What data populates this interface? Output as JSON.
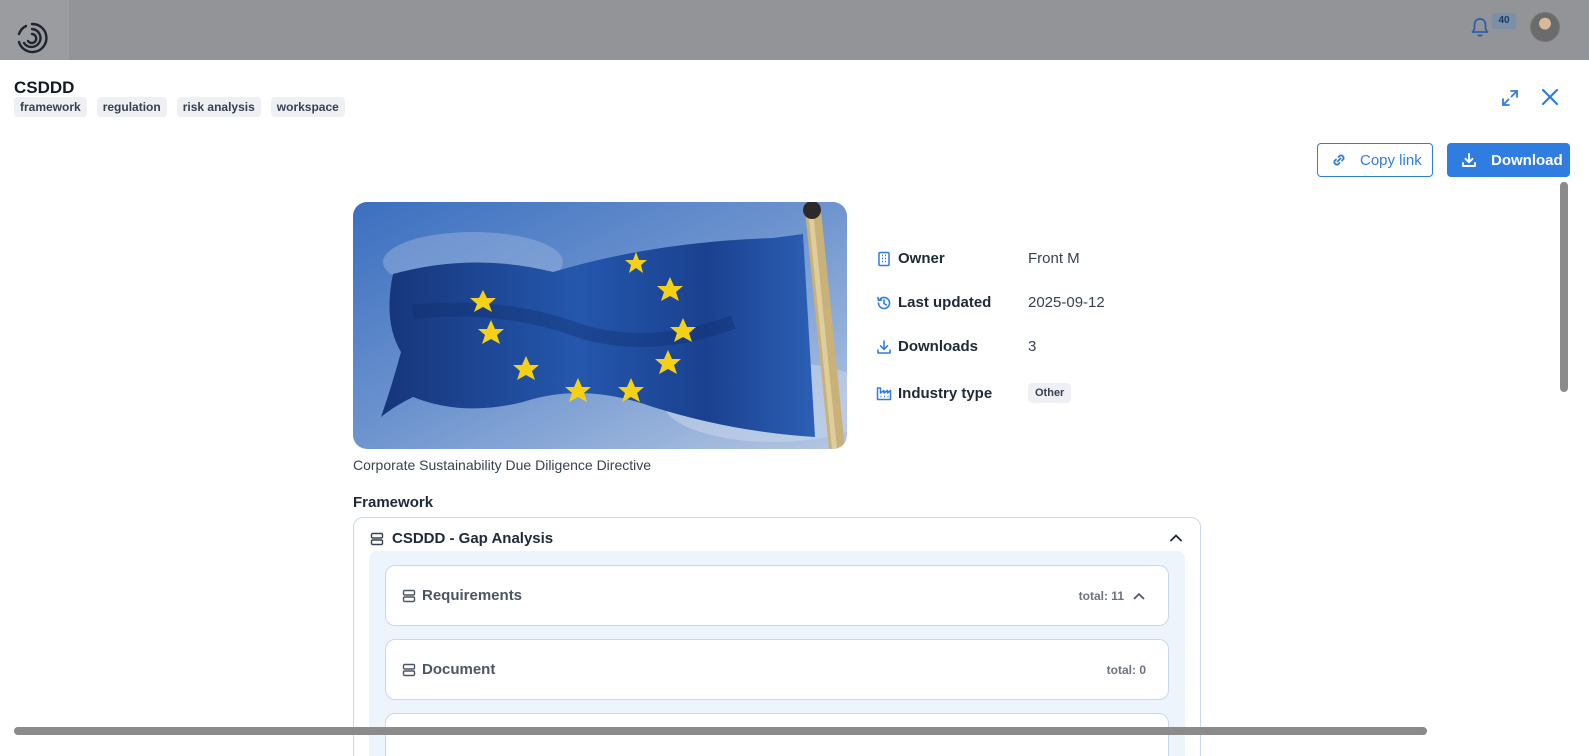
{
  "header": {
    "notification_count": "40"
  },
  "modal": {
    "title": "CSDDD",
    "tags": [
      "framework",
      "regulation",
      "risk analysis",
      "workspace"
    ],
    "copy_link_label": "Copy link",
    "download_label": "Download"
  },
  "resource": {
    "caption": "Corporate Sustainability Due Diligence Directive",
    "meta": {
      "owner_label": "Owner",
      "owner_value": "Front M",
      "updated_label": "Last updated",
      "updated_value": "2025-09-12",
      "downloads_label": "Downloads",
      "downloads_value": "3",
      "industry_label": "Industry type",
      "industry_value": "Other"
    }
  },
  "framework": {
    "section_label": "Framework",
    "name": "CSDDD - Gap Analysis",
    "items": [
      {
        "label": "Requirements",
        "total": "total: 11"
      },
      {
        "label": "Document",
        "total": "total: 0"
      }
    ]
  },
  "colors": {
    "accent": "#2f7de1",
    "flag_blue": "#1f4fa0",
    "flag_star": "#f4d116"
  }
}
